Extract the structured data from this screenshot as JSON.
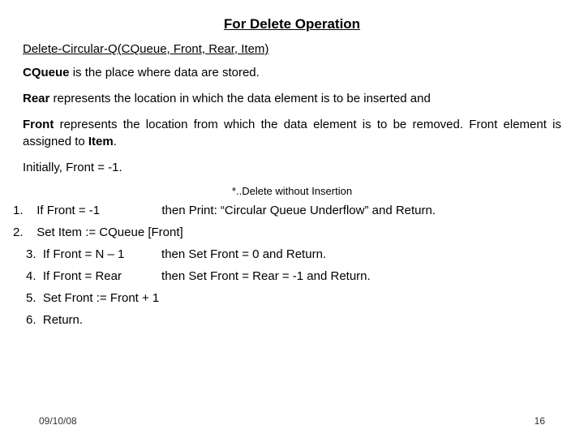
{
  "title": "For Delete Operation",
  "signature": "Delete-Circular-Q(CQueue, Front, Rear, Item)",
  "desc": {
    "cqueue": {
      "term": "CQueue",
      "text": " is the place where data are stored."
    },
    "rear": {
      "term": "Rear",
      "text": " represents the location in which the data element is to be inserted and"
    },
    "front": {
      "term": "Front",
      "text": " represents the location from which the data element is to be removed. Front element is assigned to ",
      "term2": "Item",
      "tail": "."
    },
    "initial": "Initially, Front = -1."
  },
  "note": "*..Delete without Insertion",
  "steps": [
    {
      "num": "1.",
      "cond": "If Front = -1",
      "act": "then Print: “Circular Queue Underflow” and Return."
    },
    {
      "num": "2.",
      "text": "Set Item := CQueue [Front]"
    },
    {
      "num": "3.",
      "cond": "If Front = N – 1",
      "act": "then Set Front = 0 and Return."
    },
    {
      "num": "4.",
      "cond": "If Front = Rear",
      "act": "then Set Front = Rear = -1 and Return."
    },
    {
      "num": "5.",
      "text": "Set Front := Front + 1"
    },
    {
      "num": "6.",
      "text": "Return."
    }
  ],
  "footer": {
    "date": "09/10/08",
    "page": "16"
  }
}
